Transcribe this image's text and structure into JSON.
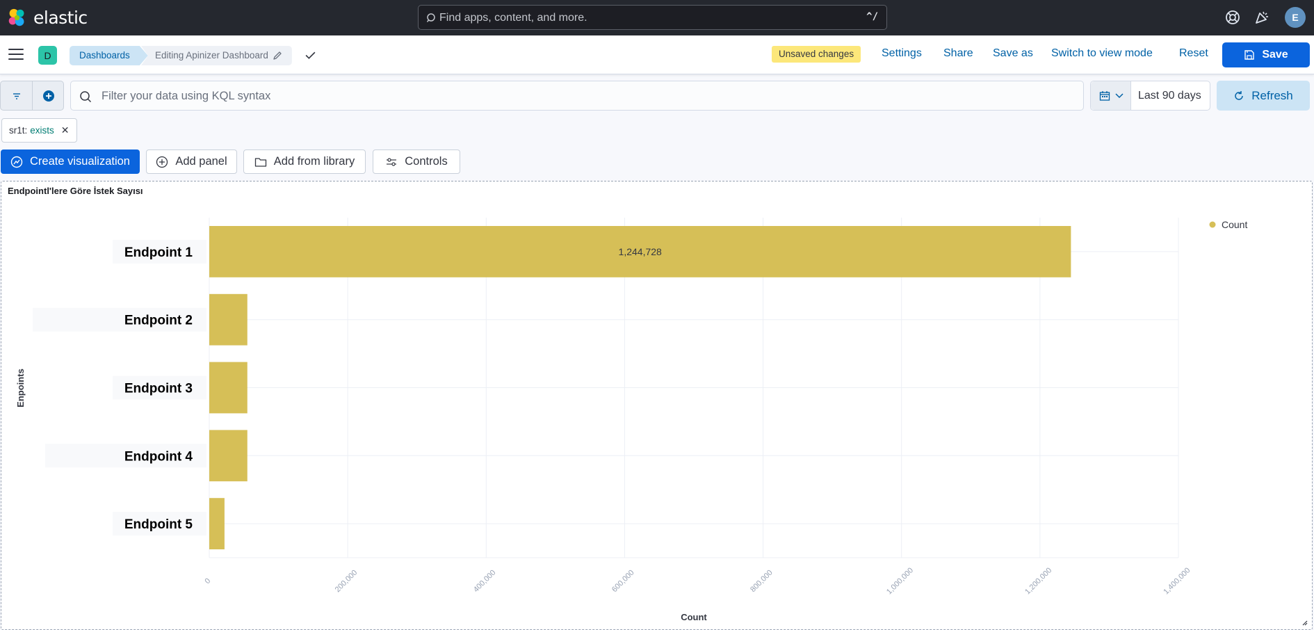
{
  "header": {
    "logo_text": "elastic",
    "search_placeholder": "Find apps, content, and more.",
    "search_shortcut": "^/",
    "user_initial": "E",
    "icons": [
      "help-icon",
      "news-icon"
    ]
  },
  "nav": {
    "space_initial": "D",
    "breadcrumb_root": "Dashboards",
    "breadcrumb_current": "Editing Apinizer Dashboard",
    "unsaved_badge": "Unsaved changes",
    "links": {
      "settings": "Settings",
      "share": "Share",
      "save_as": "Save as",
      "switch_view": "Switch to view mode",
      "reset": "Reset"
    },
    "save_label": "Save"
  },
  "query": {
    "placeholder": "Filter your data using KQL syntax",
    "date_range": "Last 90 days",
    "refresh_label": "Refresh"
  },
  "filter_pill": {
    "field": "sr1t:",
    "value": "exists"
  },
  "toolbar": {
    "create_visualization": "Create visualization",
    "add_panel": "Add panel",
    "add_from_library": "Add from library",
    "controls": "Controls"
  },
  "panel": {
    "title": "Endpointl'lere Göre İstek Sayısı"
  },
  "colors": {
    "bar": "#d6bf57",
    "primary": "#0b64dd",
    "header_bg": "#25282f"
  },
  "chart_data": {
    "type": "bar",
    "orientation": "horizontal",
    "categories": [
      "Endpoint 1",
      "Endpoint 2",
      "Endpoint 3",
      "Endpoint 4",
      "Endpoint 5"
    ],
    "values": [
      1244728,
      55000,
      55000,
      55000,
      22000
    ],
    "data_labels": [
      "1,244,728",
      "",
      "",
      "",
      ""
    ],
    "xlabel": "Count",
    "ylabel": "Enpoints",
    "xlim": [
      0,
      1400000
    ],
    "x_ticks": [
      "0",
      "200,000",
      "400,000",
      "600,000",
      "800,000",
      "1,000,000",
      "1,200,000",
      "1,400,000"
    ],
    "legend": [
      "Count"
    ],
    "legend_position": "top-right",
    "grid": true
  }
}
